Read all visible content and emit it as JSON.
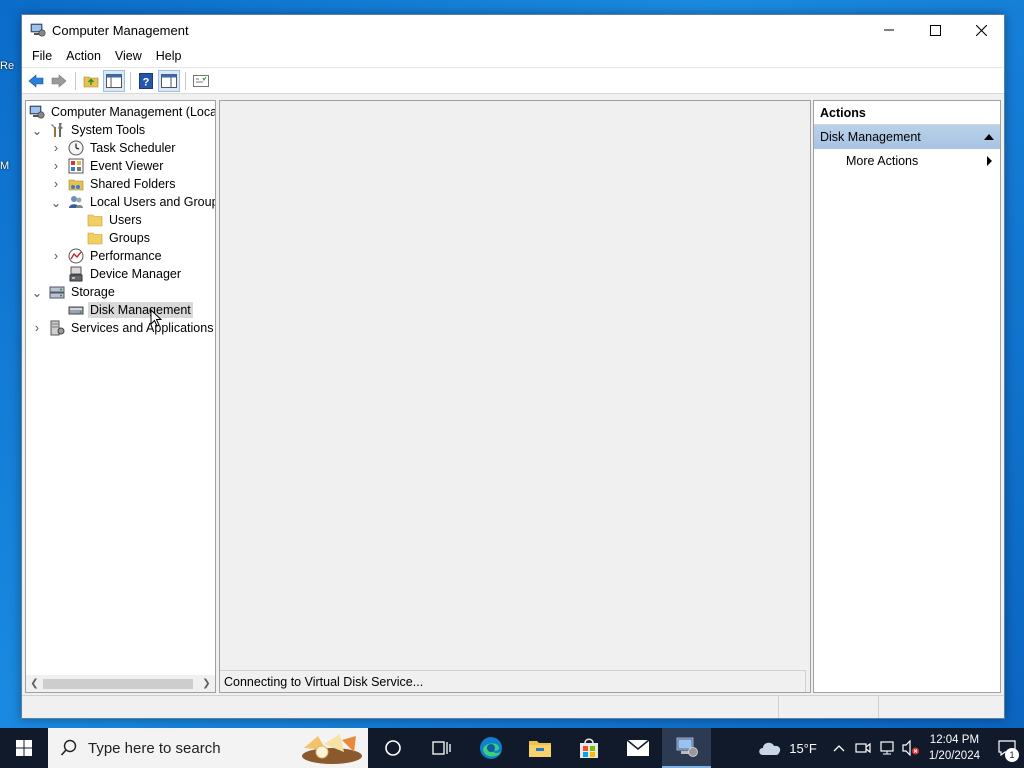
{
  "desktop": {
    "icon_label_1": "Re",
    "icon_label_2": "M"
  },
  "window": {
    "title": "Computer Management",
    "controls": [
      "minimize",
      "maximize",
      "close"
    ]
  },
  "menu": [
    "File",
    "Action",
    "View",
    "Help"
  ],
  "toolbar": {
    "buttons": [
      "back-icon",
      "forward-icon",
      "up-folder-icon",
      "show-hide-tree-icon",
      "help-icon",
      "properties-icon",
      "console-icon"
    ]
  },
  "tree": {
    "items": [
      {
        "label": "Computer Management (Local",
        "icon": "computer-management-icon"
      },
      {
        "label": "System Tools",
        "icon": "system-tools-icon",
        "expanded": true
      },
      {
        "label": "Task Scheduler",
        "icon": "clock-icon",
        "expanded": false
      },
      {
        "label": "Event Viewer",
        "icon": "event-viewer-icon",
        "expanded": false
      },
      {
        "label": "Shared Folders",
        "icon": "shared-folders-icon",
        "expanded": false
      },
      {
        "label": "Local Users and Groups",
        "icon": "users-groups-icon",
        "expanded": true
      },
      {
        "label": "Users",
        "icon": "folder-icon"
      },
      {
        "label": "Groups",
        "icon": "folder-icon"
      },
      {
        "label": "Performance",
        "icon": "performance-icon",
        "expanded": false
      },
      {
        "label": "Device Manager",
        "icon": "device-manager-icon"
      },
      {
        "label": "Storage",
        "icon": "storage-icon",
        "expanded": true
      },
      {
        "label": "Disk Management",
        "icon": "disk-icon",
        "selected": true
      },
      {
        "label": "Services and Applications",
        "icon": "services-icon",
        "expanded": false
      }
    ]
  },
  "main": {
    "status_text": "Connecting to Virtual Disk Service..."
  },
  "actions": {
    "header": "Actions",
    "section": "Disk Management",
    "items": [
      "More Actions"
    ]
  },
  "taskbar": {
    "search_placeholder": "Type here to search",
    "apps": [
      "cortana-icon",
      "task-view-icon",
      "edge-icon",
      "file-explorer-icon",
      "store-icon",
      "mail-icon",
      "computer-management-icon"
    ],
    "weather": "15°F",
    "time": "12:04 PM",
    "date": "1/20/2024",
    "notification_count": "1"
  },
  "colors": {
    "desktop": "#0b6cc9",
    "taskbar": "#101a2b",
    "actions_section": "#b9d1ea",
    "selection": "#d9d9d9"
  }
}
